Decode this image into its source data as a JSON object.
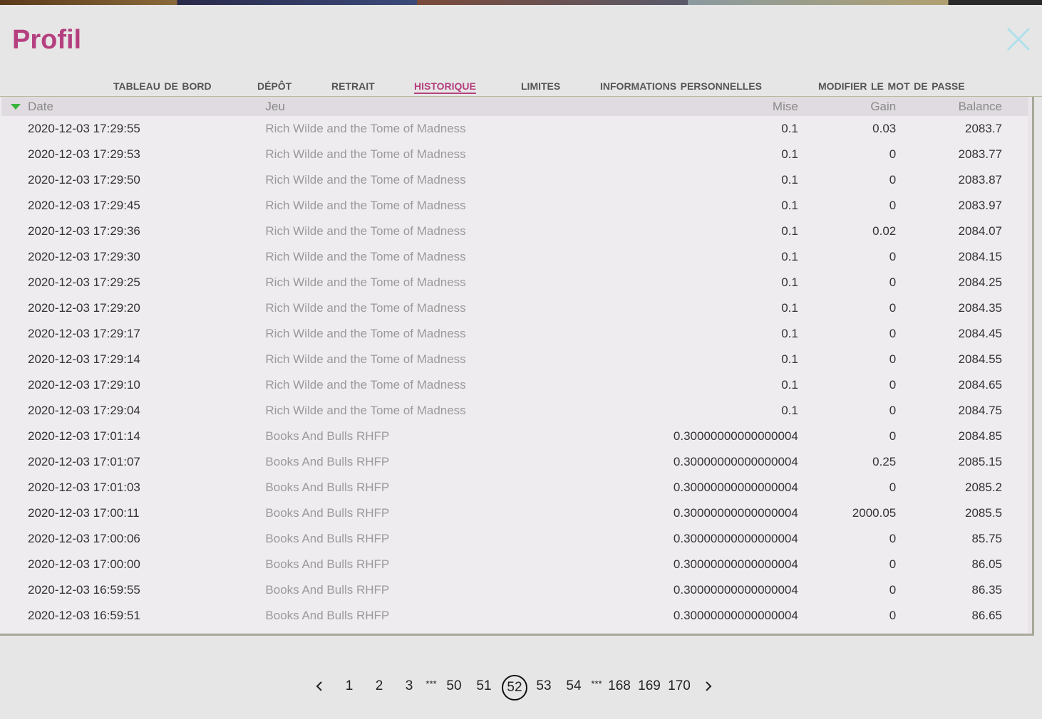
{
  "modal": {
    "title": "Profil",
    "close_icon": "close-icon",
    "accent_color": "#b5407f"
  },
  "tabs": [
    {
      "label": "Tableau de bord",
      "active": false
    },
    {
      "label": "Dépôt",
      "active": false
    },
    {
      "label": "Retrait",
      "active": false
    },
    {
      "label": "Historique",
      "active": true
    },
    {
      "label": "Limites",
      "active": false
    },
    {
      "label": "Informations personnelles",
      "active": false
    },
    {
      "label": "Modifier le mot de passe",
      "active": false
    }
  ],
  "table": {
    "columns": {
      "date": "Date",
      "game": "Jeu",
      "bet": "Mise",
      "win": "Gain",
      "balance": "Balance"
    },
    "sort_icon": "sort-down-icon",
    "rows": [
      {
        "date": "2020-12-03 17:29:55",
        "game": "Rich Wilde and the Tome of Madness",
        "bet": "0.1",
        "win": "0.03",
        "balance": "2083.7"
      },
      {
        "date": "2020-12-03 17:29:53",
        "game": "Rich Wilde and the Tome of Madness",
        "bet": "0.1",
        "win": "0",
        "balance": "2083.77"
      },
      {
        "date": "2020-12-03 17:29:50",
        "game": "Rich Wilde and the Tome of Madness",
        "bet": "0.1",
        "win": "0",
        "balance": "2083.87"
      },
      {
        "date": "2020-12-03 17:29:45",
        "game": "Rich Wilde and the Tome of Madness",
        "bet": "0.1",
        "win": "0",
        "balance": "2083.97"
      },
      {
        "date": "2020-12-03 17:29:36",
        "game": "Rich Wilde and the Tome of Madness",
        "bet": "0.1",
        "win": "0.02",
        "balance": "2084.07"
      },
      {
        "date": "2020-12-03 17:29:30",
        "game": "Rich Wilde and the Tome of Madness",
        "bet": "0.1",
        "win": "0",
        "balance": "2084.15"
      },
      {
        "date": "2020-12-03 17:29:25",
        "game": "Rich Wilde and the Tome of Madness",
        "bet": "0.1",
        "win": "0",
        "balance": "2084.25"
      },
      {
        "date": "2020-12-03 17:29:20",
        "game": "Rich Wilde and the Tome of Madness",
        "bet": "0.1",
        "win": "0",
        "balance": "2084.35"
      },
      {
        "date": "2020-12-03 17:29:17",
        "game": "Rich Wilde and the Tome of Madness",
        "bet": "0.1",
        "win": "0",
        "balance": "2084.45"
      },
      {
        "date": "2020-12-03 17:29:14",
        "game": "Rich Wilde and the Tome of Madness",
        "bet": "0.1",
        "win": "0",
        "balance": "2084.55"
      },
      {
        "date": "2020-12-03 17:29:10",
        "game": "Rich Wilde and the Tome of Madness",
        "bet": "0.1",
        "win": "0",
        "balance": "2084.65"
      },
      {
        "date": "2020-12-03 17:29:04",
        "game": "Rich Wilde and the Tome of Madness",
        "bet": "0.1",
        "win": "0",
        "balance": "2084.75"
      },
      {
        "date": "2020-12-03 17:01:14",
        "game": "Books And Bulls RHFP",
        "bet": "0.30000000000000004",
        "win": "0",
        "balance": "2084.85"
      },
      {
        "date": "2020-12-03 17:01:07",
        "game": "Books And Bulls RHFP",
        "bet": "0.30000000000000004",
        "win": "0.25",
        "balance": "2085.15"
      },
      {
        "date": "2020-12-03 17:01:03",
        "game": "Books And Bulls RHFP",
        "bet": "0.30000000000000004",
        "win": "0",
        "balance": "2085.2"
      },
      {
        "date": "2020-12-03 17:00:11",
        "game": "Books And Bulls RHFP",
        "bet": "0.30000000000000004",
        "win": "2000.05",
        "balance": "2085.5"
      },
      {
        "date": "2020-12-03 17:00:06",
        "game": "Books And Bulls RHFP",
        "bet": "0.30000000000000004",
        "win": "0",
        "balance": "85.75"
      },
      {
        "date": "2020-12-03 17:00:00",
        "game": "Books And Bulls RHFP",
        "bet": "0.30000000000000004",
        "win": "0",
        "balance": "86.05"
      },
      {
        "date": "2020-12-03 16:59:55",
        "game": "Books And Bulls RHFP",
        "bet": "0.30000000000000004",
        "win": "0",
        "balance": "86.35"
      },
      {
        "date": "2020-12-03 16:59:51",
        "game": "Books And Bulls RHFP",
        "bet": "0.30000000000000004",
        "win": "0",
        "balance": "86.65"
      }
    ]
  },
  "pagination": {
    "prev_icon": "chevron-left-icon",
    "next_icon": "chevron-right-icon",
    "ellipsis": "***",
    "current": "52",
    "pages": [
      "1",
      "2",
      "3",
      "***",
      "50",
      "51",
      "52",
      "53",
      "54",
      "***",
      "168",
      "169",
      "170"
    ]
  }
}
